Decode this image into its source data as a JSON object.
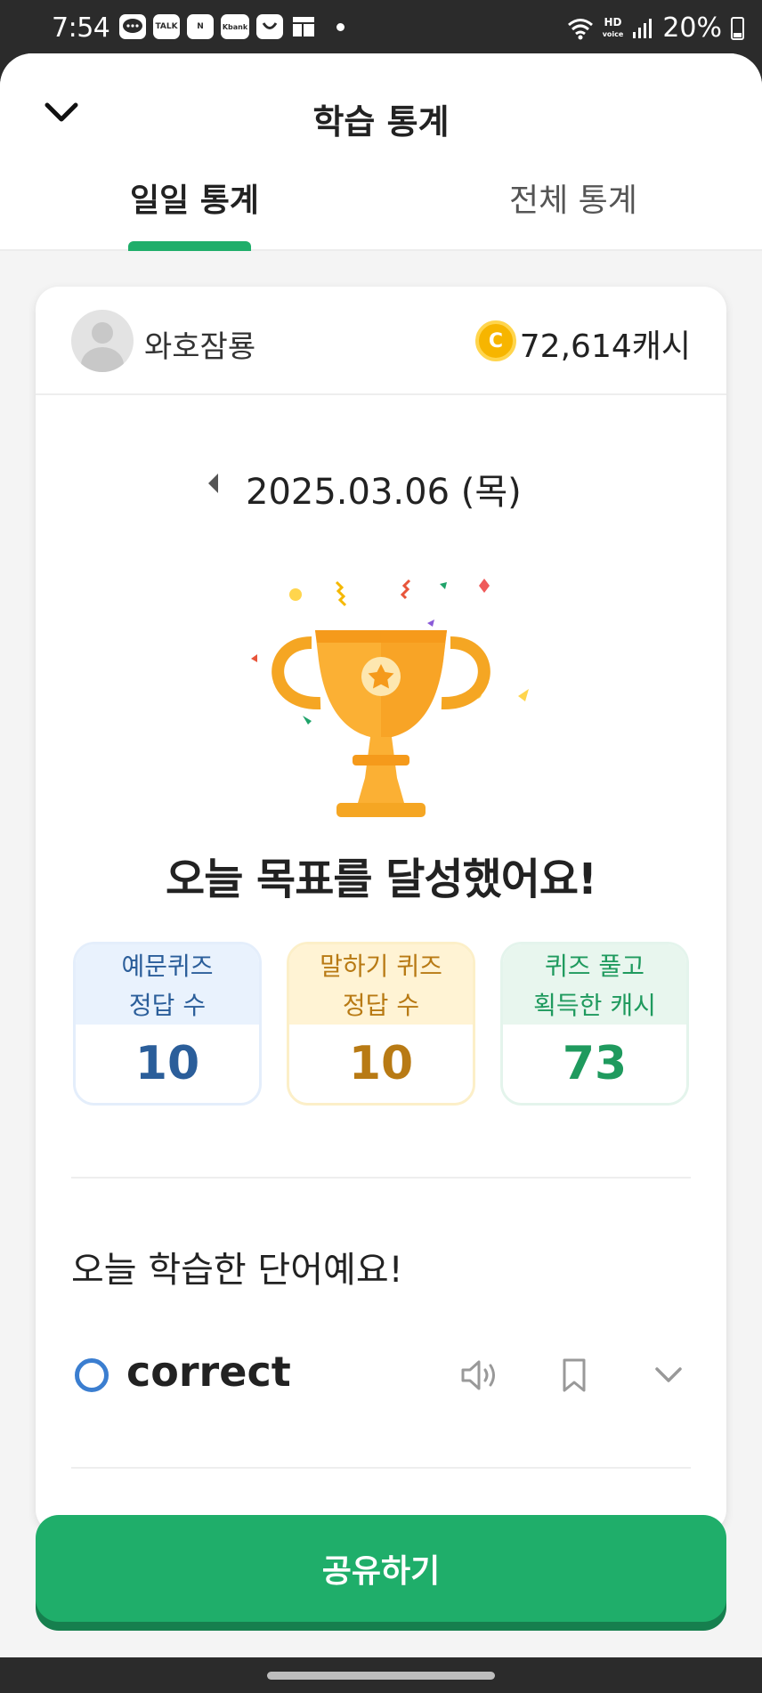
{
  "status_bar": {
    "time": "7:54",
    "app_icons": [
      "message-icon",
      "kakaotalk-icon",
      "naver-icon",
      "kbank-icon",
      "coupang-icon",
      "gallery-icon"
    ],
    "app_icon_labels": [
      "",
      "TALK",
      "N",
      "Kbank",
      "",
      ""
    ],
    "network_label": "HD",
    "battery": "20%"
  },
  "header": {
    "title": "학습 통계",
    "tabs": [
      {
        "label": "일일 통계",
        "selected": true
      },
      {
        "label": "전체 통계",
        "selected": false
      }
    ],
    "accent_color": "#1fae6a"
  },
  "card": {
    "username": "와호잠룡",
    "coin_symbol": "C",
    "cash": "72,614캐시",
    "date": "2025.03.06 (목)",
    "goal_message": "오늘 목표를 달성했어요!",
    "stats": [
      {
        "label_line1": "예문퀴즈",
        "label_line2": "정답 수",
        "value": "10",
        "color": "#2b5e9a"
      },
      {
        "label_line1": "말하기 퀴즈",
        "label_line2": "정답 수",
        "value": "10",
        "color": "#b87a14"
      },
      {
        "label_line1": "퀴즈 풀고",
        "label_line2": "획득한 캐시",
        "value": "73",
        "color": "#1f9a5e"
      }
    ],
    "words_title": "오늘 학습한 단어예요!",
    "words": [
      {
        "status": "correct-circle-icon",
        "word": "correct"
      }
    ]
  },
  "share_button": {
    "label": "공유하기"
  }
}
